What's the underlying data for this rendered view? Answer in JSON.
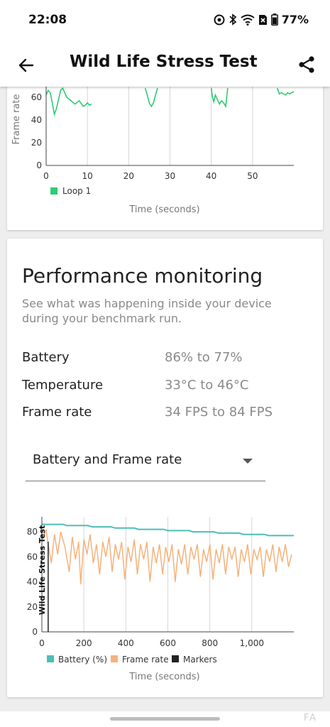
{
  "status_bar": {
    "time": "22:08",
    "battery_pct": "77%",
    "icons": [
      "data-saver-icon",
      "bluetooth-icon",
      "wifi-icon",
      "no-sim-icon",
      "battery-icon"
    ]
  },
  "app_bar": {
    "title": "Wild Life Stress Test",
    "back_icon": "arrow-left-icon",
    "share_icon": "share-icon"
  },
  "loop_chart": {
    "ylabel": "Frame rate",
    "xlabel": "Time (seconds)",
    "legend": "Loop 1",
    "color": "#2ecc71"
  },
  "performance": {
    "title": "Performance monitoring",
    "subtitle": "See what was happening inside your device during your benchmark run.",
    "stats": [
      {
        "label": "Battery",
        "value": "86% to 77%"
      },
      {
        "label": "Temperature",
        "value": "33°C to 46°C"
      },
      {
        "label": "Frame rate",
        "value": "34 FPS to 84 FPS"
      }
    ],
    "dropdown_value": "Battery and Frame rate"
  },
  "perf_chart": {
    "marker_label": "Wild Life Stress Test",
    "xlabel": "Time (seconds)",
    "legend": [
      {
        "name": "Battery (%)",
        "color": "#4dbdb8"
      },
      {
        "name": "Frame rate",
        "color": "#f5b27a"
      },
      {
        "name": "Markers",
        "color": "#222222"
      }
    ]
  },
  "watermark": "FA",
  "chart_data": [
    {
      "type": "line",
      "title": "",
      "xlabel": "Time (seconds)",
      "ylabel": "Frame rate",
      "x_ticks": [
        0,
        10,
        20,
        30,
        40,
        50
      ],
      "y_ticks": [
        0,
        20,
        40,
        60
      ],
      "xlim": [
        0,
        60
      ],
      "ylim_visible": [
        0,
        68
      ],
      "grid": "vertical",
      "legend_position": "bottom-left",
      "series": [
        {
          "name": "Loop 1",
          "color": "#2ecc71",
          "points": [
            [
              0,
              62
            ],
            [
              0.5,
              66
            ],
            [
              1,
              64
            ],
            [
              1.5,
              55
            ],
            [
              2,
              45
            ],
            [
              2.5,
              50
            ],
            [
              3,
              58
            ],
            [
              3.5,
              66
            ],
            [
              4,
              68
            ],
            [
              5,
              60
            ],
            [
              6,
              57
            ],
            [
              7,
              54
            ],
            [
              8,
              57
            ],
            [
              9,
              52
            ],
            [
              9.5,
              53
            ],
            [
              10,
              55
            ],
            [
              10.5,
              53
            ],
            [
              11,
              54
            ],
            [
              24,
              68
            ],
            [
              24.5,
              62
            ],
            [
              25,
              55
            ],
            [
              25.5,
              52
            ],
            [
              26,
              55
            ],
            [
              26.5,
              62
            ],
            [
              27,
              68
            ],
            [
              40,
              68
            ],
            [
              40.3,
              60
            ],
            [
              40.6,
              56
            ],
            [
              41,
              62
            ],
            [
              41.5,
              58
            ],
            [
              42,
              54
            ],
            [
              42.5,
              57
            ],
            [
              43,
              55
            ],
            [
              43.5,
              52
            ],
            [
              44,
              68
            ],
            [
              56,
              68
            ],
            [
              56.5,
              63
            ],
            [
              57,
              64
            ],
            [
              58,
              62
            ],
            [
              58.5,
              64
            ],
            [
              59,
              63
            ],
            [
              59.5,
              64
            ],
            [
              60,
              65
            ]
          ]
        }
      ]
    },
    {
      "type": "line",
      "title": "",
      "xlabel": "Time (seconds)",
      "ylabel": "",
      "x_ticks": [
        0,
        200,
        400,
        600,
        800,
        1000
      ],
      "x_tick_labels": [
        "0",
        "200",
        "400",
        "600",
        "800",
        "1,000"
      ],
      "y_ticks": [
        0,
        20,
        40,
        60,
        80
      ],
      "xlim": [
        0,
        1200
      ],
      "ylim": [
        0,
        92
      ],
      "grid": "vertical",
      "legend_position": "bottom",
      "markers": [
        {
          "x": 30,
          "label": "Wild Life Stress Test"
        }
      ],
      "series": [
        {
          "name": "Battery (%)",
          "color": "#4dbdb8",
          "points": [
            [
              0,
              86
            ],
            [
              100,
              86
            ],
            [
              120,
              85
            ],
            [
              220,
              85
            ],
            [
              240,
              84
            ],
            [
              330,
              84
            ],
            [
              350,
              83
            ],
            [
              440,
              83
            ],
            [
              460,
              82
            ],
            [
              580,
              82
            ],
            [
              600,
              81
            ],
            [
              700,
              81
            ],
            [
              720,
              80
            ],
            [
              820,
              80
            ],
            [
              840,
              79
            ],
            [
              940,
              79
            ],
            [
              960,
              78
            ],
            [
              1060,
              78
            ],
            [
              1080,
              77
            ],
            [
              1200,
              77
            ]
          ]
        },
        {
          "name": "Frame rate",
          "color": "#f5b27a",
          "points": [
            [
              5,
              75
            ],
            [
              20,
              82
            ],
            [
              30,
              70
            ],
            [
              45,
              55
            ],
            [
              60,
              78
            ],
            [
              75,
              62
            ],
            [
              90,
              80
            ],
            [
              110,
              68
            ],
            [
              130,
              48
            ],
            [
              145,
              76
            ],
            [
              160,
              58
            ],
            [
              175,
              72
            ],
            [
              185,
              38
            ],
            [
              200,
              74
            ],
            [
              215,
              62
            ],
            [
              230,
              78
            ],
            [
              245,
              55
            ],
            [
              260,
              70
            ],
            [
              275,
              46
            ],
            [
              290,
              72
            ],
            [
              305,
              60
            ],
            [
              320,
              76
            ],
            [
              335,
              48
            ],
            [
              350,
              70
            ],
            [
              365,
              58
            ],
            [
              380,
              72
            ],
            [
              395,
              42
            ],
            [
              410,
              68
            ],
            [
              425,
              56
            ],
            [
              440,
              74
            ],
            [
              455,
              46
            ],
            [
              470,
              70
            ],
            [
              485,
              58
            ],
            [
              500,
              72
            ],
            [
              515,
              40
            ],
            [
              530,
              68
            ],
            [
              545,
              55
            ],
            [
              560,
              70
            ],
            [
              575,
              46
            ],
            [
              590,
              68
            ],
            [
              605,
              56
            ],
            [
              620,
              70
            ],
            [
              635,
              40
            ],
            [
              650,
              66
            ],
            [
              665,
              54
            ],
            [
              680,
              70
            ],
            [
              695,
              46
            ],
            [
              710,
              68
            ],
            [
              725,
              58
            ],
            [
              740,
              70
            ],
            [
              755,
              44
            ],
            [
              770,
              66
            ],
            [
              785,
              56
            ],
            [
              800,
              70
            ],
            [
              815,
              42
            ],
            [
              830,
              66
            ],
            [
              845,
              55
            ],
            [
              860,
              70
            ],
            [
              875,
              46
            ],
            [
              890,
              68
            ],
            [
              905,
              58
            ],
            [
              920,
              68
            ],
            [
              935,
              44
            ],
            [
              950,
              66
            ],
            [
              965,
              56
            ],
            [
              980,
              70
            ],
            [
              995,
              46
            ],
            [
              1010,
              66
            ],
            [
              1025,
              58
            ],
            [
              1040,
              68
            ],
            [
              1055,
              44
            ],
            [
              1070,
              66
            ],
            [
              1085,
              56
            ],
            [
              1100,
              70
            ],
            [
              1115,
              48
            ],
            [
              1130,
              68
            ],
            [
              1145,
              56
            ],
            [
              1160,
              70
            ],
            [
              1175,
              52
            ],
            [
              1190,
              62
            ]
          ]
        }
      ]
    }
  ]
}
